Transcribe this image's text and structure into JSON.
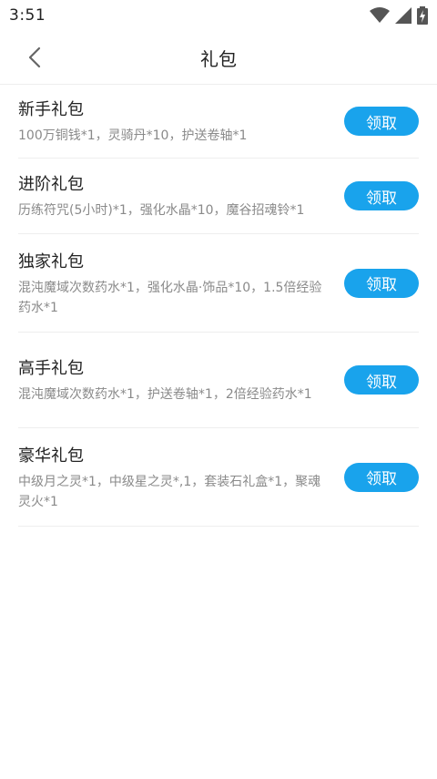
{
  "status": {
    "time": "3:51"
  },
  "header": {
    "title": "礼包"
  },
  "packages": [
    {
      "title": "新手礼包",
      "desc": "100万铜钱*1，灵骑丹*10，护送卷轴*1",
      "button": "领取"
    },
    {
      "title": "进阶礼包",
      "desc": "历练符咒(5小时)*1，强化水晶*10，魔谷招魂铃*1",
      "button": "领取"
    },
    {
      "title": "独家礼包",
      "desc": "混沌魔域次数药水*1，强化水晶·饰品*10，1.5倍经验药水*1",
      "button": "领取"
    },
    {
      "title": "高手礼包",
      "desc": "混沌魔域次数药水*1，护送卷轴*1，2倍经验药水*1",
      "button": "领取"
    },
    {
      "title": "豪华礼包",
      "desc": "中级月之灵*1，中级星之灵*,1，套装石礼盒*1，聚魂灵火*1",
      "button": "领取"
    }
  ],
  "colors": {
    "accent": "#19a3ec"
  },
  "icons": [
    "wifi-icon",
    "signal-icon",
    "battery-charging-icon",
    "back-arrow-icon"
  ]
}
